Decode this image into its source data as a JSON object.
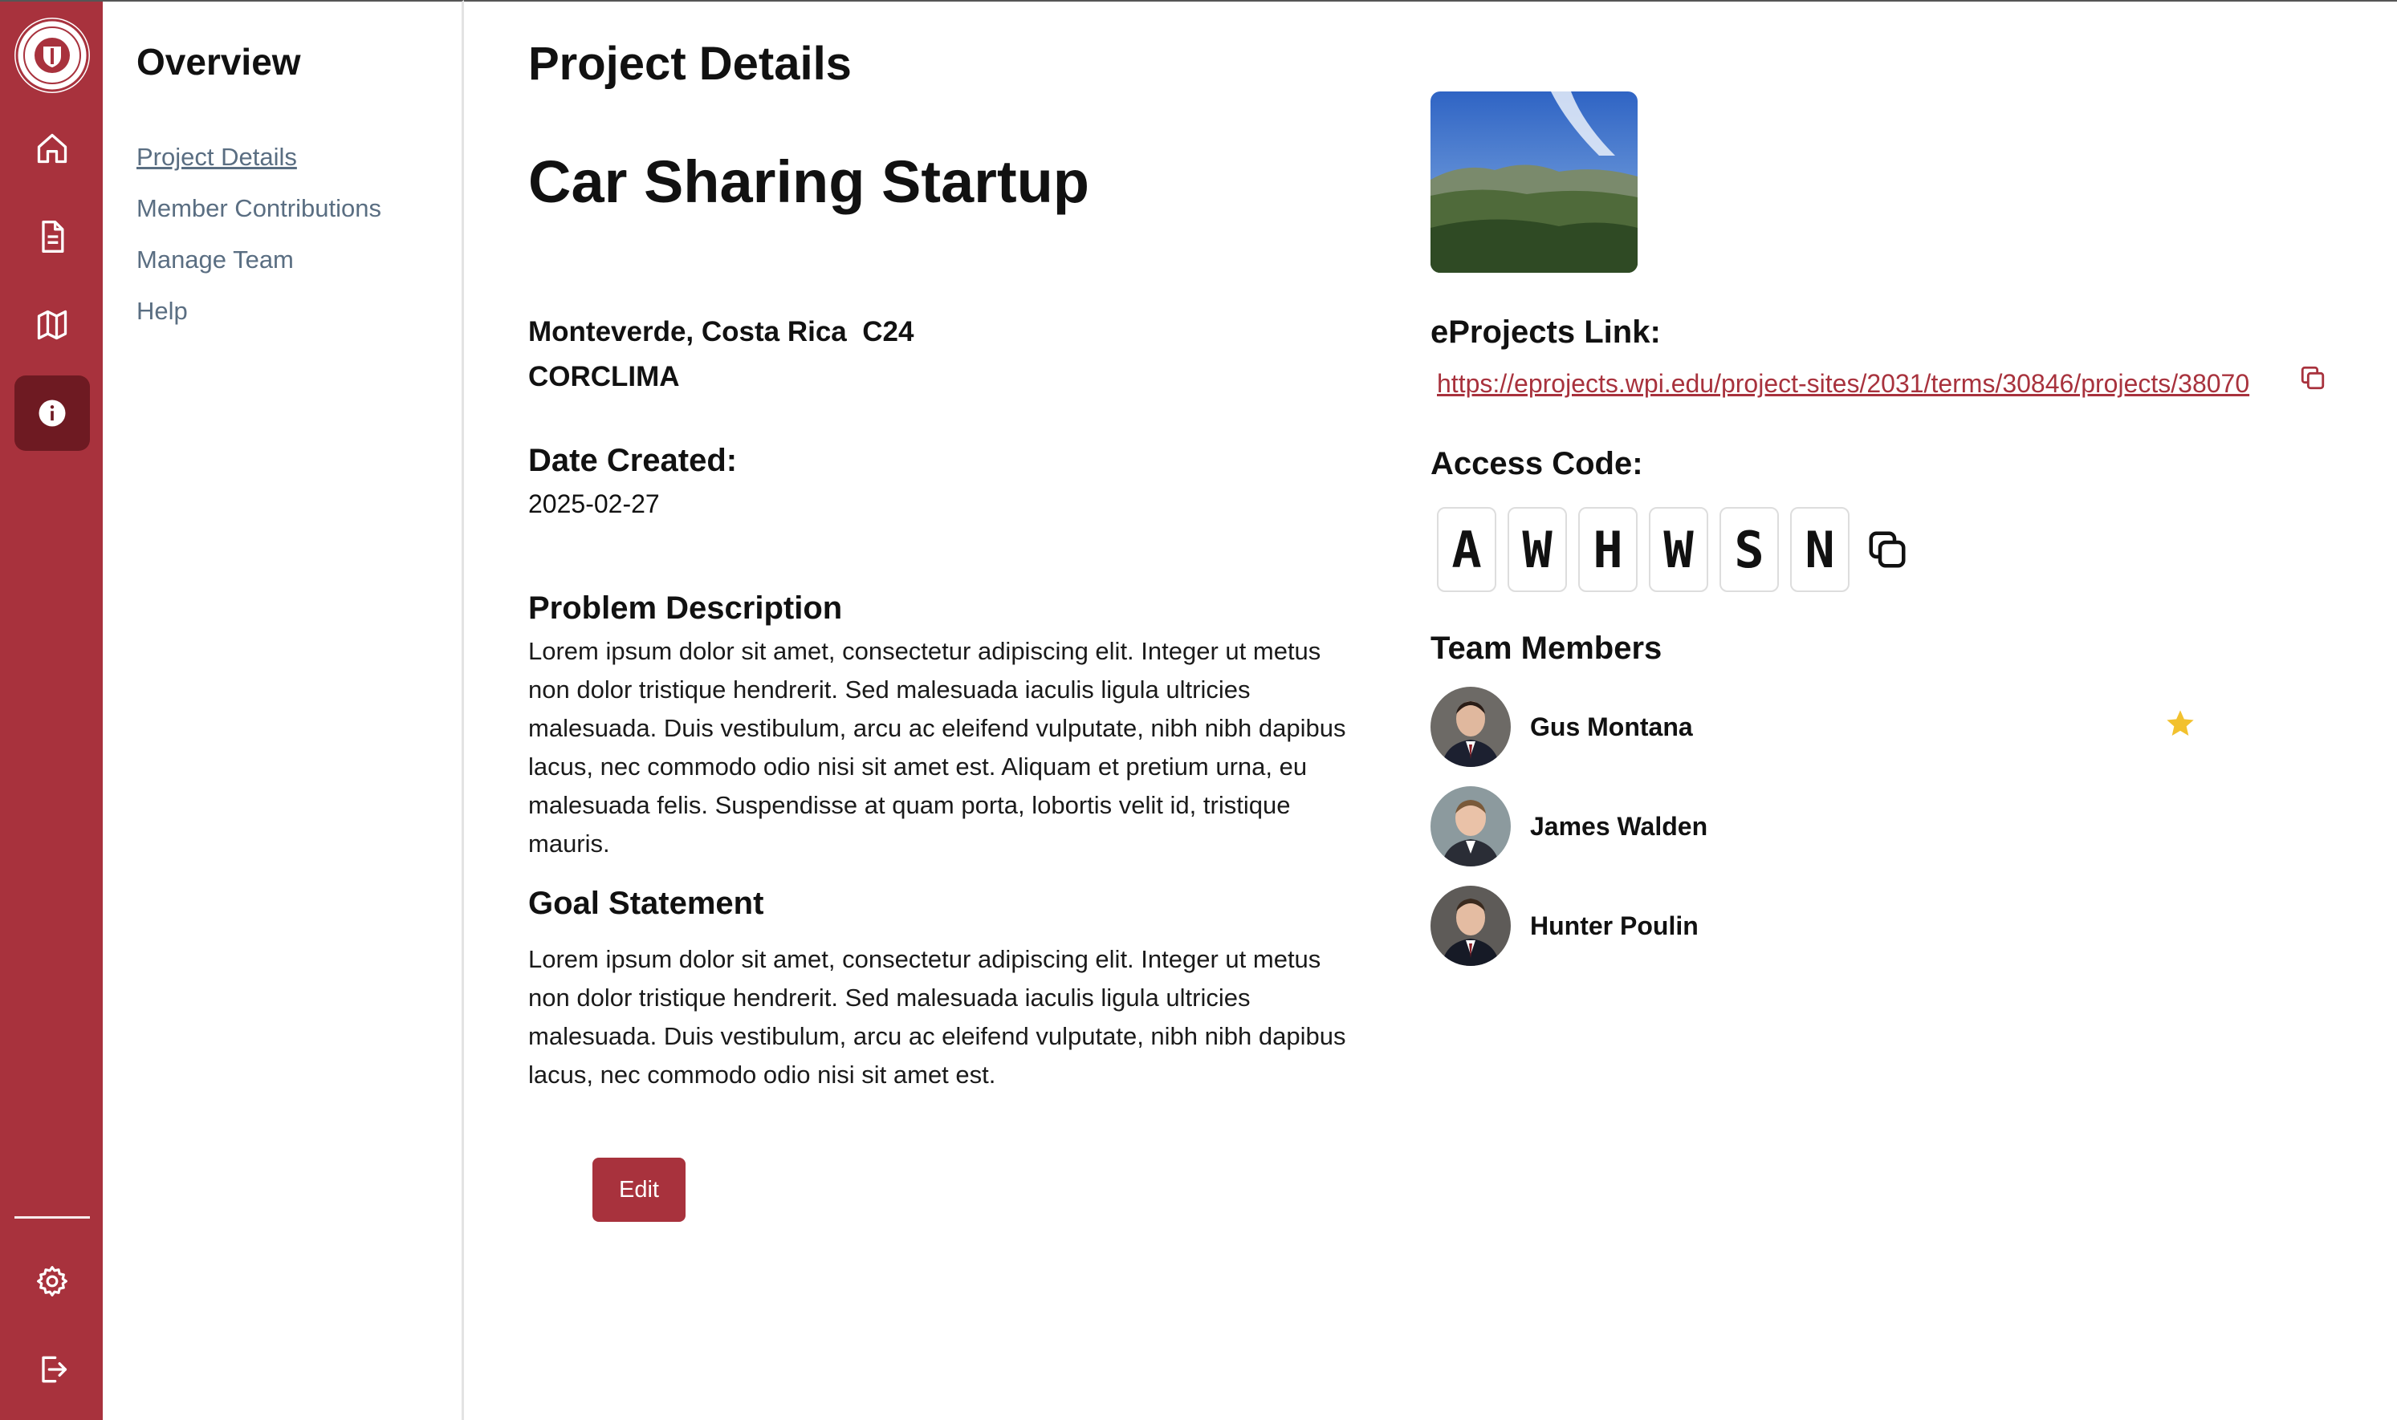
{
  "colors": {
    "accent": "#a8323d",
    "accent_dark": "#6e1a22",
    "nav_text": "#5a6e82",
    "star": "#f2c12e"
  },
  "rail": {
    "items": [
      {
        "icon": "university-seal-icon"
      },
      {
        "icon": "home-icon"
      },
      {
        "icon": "document-icon"
      },
      {
        "icon": "map-icon"
      },
      {
        "icon": "info-icon",
        "active": true
      },
      {
        "icon": "gear-icon"
      },
      {
        "icon": "logout-icon"
      }
    ]
  },
  "overview": {
    "title": "Overview",
    "nav": [
      "Project Details",
      "Member Contributions",
      "Manage Team",
      "Help"
    ],
    "active": "Project Details"
  },
  "main": {
    "page_title": "Project Details",
    "project_name": "Car Sharing Startup",
    "location": "Monteverde, Costa Rica  C24",
    "sponsor": "CORCLIMA",
    "date_label": "Date Created:",
    "date_value": "2025-02-27",
    "problem_heading": "Problem Description",
    "problem_text": "Lorem ipsum dolor sit amet, consectetur adipiscing elit. Integer ut metus non dolor tristique hendrerit. Sed malesuada iaculis ligula ultricies malesuada. Duis vestibulum, arcu ac eleifend vulputate, nibh nibh dapibus lacus, nec commodo odio nisi sit amet est. Aliquam et pretium urna, eu malesuada felis. Suspendisse at quam porta, lobortis velit id, tristique mauris.",
    "goal_heading": "Goal Statement",
    "goal_text": "Lorem ipsum dolor sit amet, consectetur adipiscing elit. Integer ut metus non dolor tristique hendrerit. Sed malesuada iaculis ligula ultricies malesuada. Duis vestibulum, arcu ac eleifend vulputate, nibh nibh dapibus lacus, nec commodo odio nisi sit amet est.",
    "edit_label": "Edit"
  },
  "right": {
    "link_label": "eProjects Link:",
    "link_url": "https://eprojects.wpi.edu/project-sites/2031/terms/30846/projects/38070",
    "access_label": "Access Code:",
    "access_code": [
      "A",
      "W",
      "H",
      "W",
      "S",
      "N"
    ],
    "team_label": "Team Members",
    "members": [
      {
        "name": "Gus Montana",
        "leader": true
      },
      {
        "name": "James Walden",
        "leader": false
      },
      {
        "name": "Hunter Poulin",
        "leader": false
      }
    ]
  }
}
